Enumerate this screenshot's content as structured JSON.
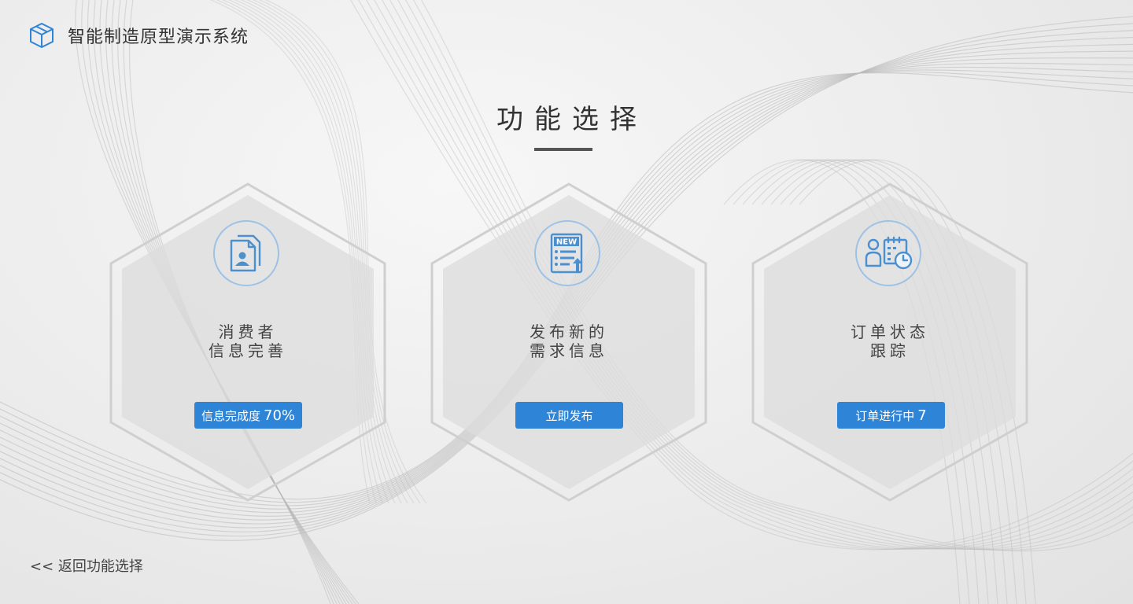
{
  "app": {
    "title": "智能制造原型演示系统",
    "logo_icon": "cube-icon"
  },
  "page": {
    "title": "功能选择"
  },
  "cards": [
    {
      "icon": "consumer-document-icon",
      "label_line1": "消费者",
      "label_line2": "信息完善",
      "button_text": "信息完成度",
      "button_value": "70%"
    },
    {
      "icon": "new-document-icon",
      "label_line1": "发布新的",
      "label_line2": "需求信息",
      "button_text": "立即发布",
      "button_value": ""
    },
    {
      "icon": "order-status-icon",
      "label_line1": "订单状态",
      "label_line2": "跟踪",
      "button_text": "订单进行中",
      "button_value": "7"
    }
  ],
  "footer": {
    "back_label": "<< 返回功能选择"
  },
  "colors": {
    "accent": "#2e84d6",
    "icon": "#4a90d0",
    "icon_ring": "#9ec2e6",
    "hex_fill": "#dcdcdc"
  }
}
